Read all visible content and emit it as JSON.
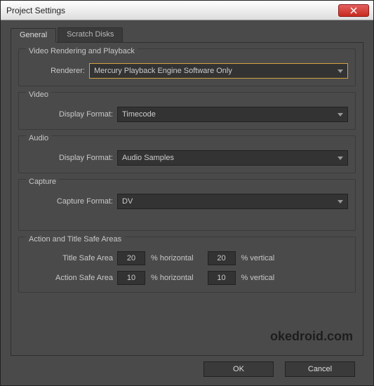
{
  "window": {
    "title": "Project Settings"
  },
  "tabs": {
    "general": "General",
    "scratch": "Scratch Disks"
  },
  "groups": {
    "render": {
      "title": "Video Rendering and Playback",
      "renderer_label": "Renderer:",
      "renderer_value": "Mercury Playback Engine Software Only"
    },
    "video": {
      "title": "Video",
      "display_label": "Display Format:",
      "display_value": "Timecode"
    },
    "audio": {
      "title": "Audio",
      "display_label": "Display Format:",
      "display_value": "Audio Samples"
    },
    "capture": {
      "title": "Capture",
      "capture_label": "Capture Format:",
      "capture_value": "DV"
    },
    "safe": {
      "title": "Action and Title Safe Areas",
      "title_safe_label": "Title Safe Area",
      "title_safe_h": "20",
      "title_safe_v": "20",
      "action_safe_label": "Action Safe Area",
      "action_safe_h": "10",
      "action_safe_v": "10",
      "pct_h": "% horizontal",
      "pct_v": "% vertical"
    }
  },
  "buttons": {
    "ok": "OK",
    "cancel": "Cancel"
  },
  "watermark": "okedroid.com"
}
